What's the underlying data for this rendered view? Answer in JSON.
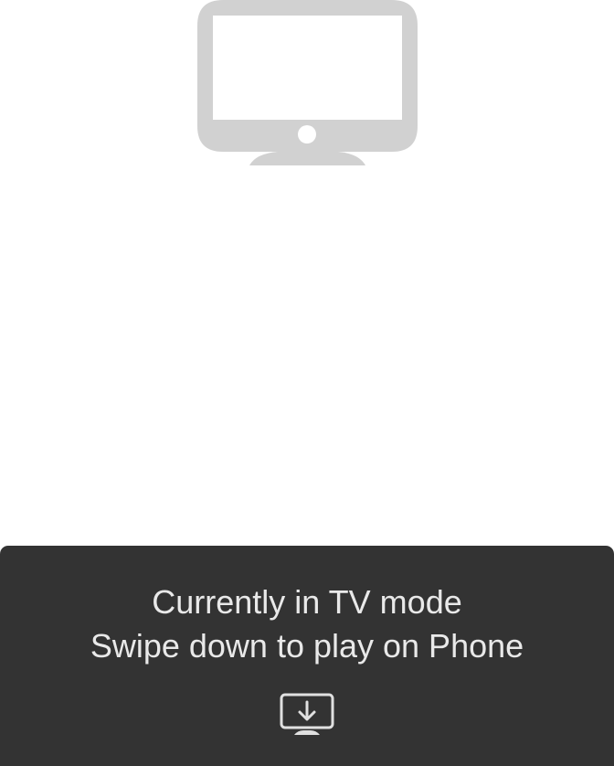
{
  "screen": {
    "illustration_icon": "tv-icon",
    "illustration_color": "#d1d1d1"
  },
  "mode_panel": {
    "background_color": "#333333",
    "title": "Currently in TV mode",
    "subtitle": "Swipe down to play on Phone",
    "switch_icon": "tv-download-arrow-icon"
  }
}
